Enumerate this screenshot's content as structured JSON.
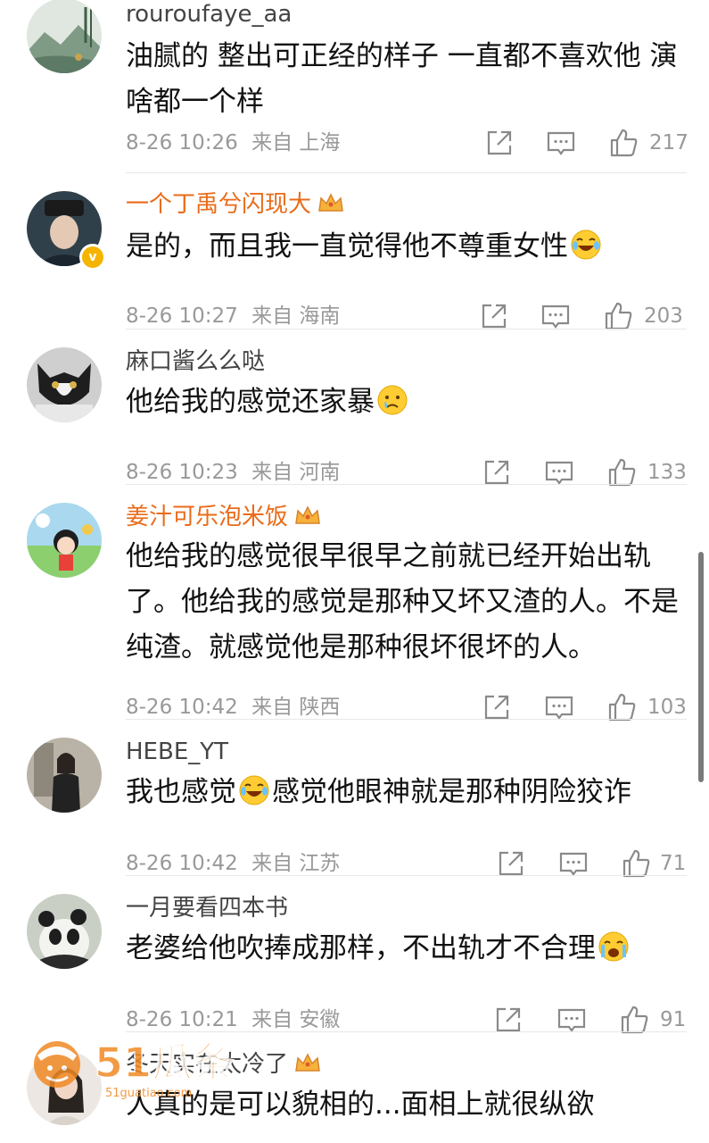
{
  "comments": [
    {
      "username": "rouroufaye_aa",
      "username_style": "normal",
      "verified": false,
      "crown": false,
      "text": "油腻的 整出可正经的样子 一直都不喜欢他 演啥都一个样",
      "emoji": null,
      "time": "8-26 10:26",
      "source": "来自",
      "location": "上海",
      "likes": "217",
      "avatar_desc": "landscape-painting-avatar"
    },
    {
      "username": "一个丁禹兮闪现大",
      "username_style": "vip",
      "verified": true,
      "crown": true,
      "text": "是的，而且我一直觉得他不尊重女性",
      "emoji": "laughing-crying-emoji",
      "time": "8-26 10:27",
      "source": "来自",
      "location": "海南",
      "likes": "203",
      "avatar_desc": "man-in-costume-hat-avatar"
    },
    {
      "username": "麻口酱么么哒",
      "username_style": "normal",
      "verified": false,
      "crown": false,
      "text": "他给我的感觉还家暴",
      "emoji": "sad-tear-emoji",
      "time": "8-26 10:23",
      "source": "来自",
      "location": "河南",
      "likes": "133",
      "avatar_desc": "cat-avatar"
    },
    {
      "username": "姜汁可乐泡米饭",
      "username_style": "vip",
      "verified": false,
      "crown": true,
      "text": "他给我的感觉很早很早之前就已经开始出轨了。他给我的感觉是那种又坏又渣的人。不是纯渣。就感觉他是那种很坏很坏的人。",
      "emoji": null,
      "time": "8-26 10:42",
      "source": "来自",
      "location": "陕西",
      "likes": "103",
      "avatar_desc": "cartoon-girl-avatar"
    },
    {
      "username": "HEBE_YT",
      "username_style": "normal",
      "verified": false,
      "crown": false,
      "text_before": "我也感觉",
      "text_after": "感觉他眼神就是那种阴险狡诈",
      "text": "",
      "emoji": "laughing-crying-emoji",
      "emoji_inline": true,
      "time": "8-26 10:42",
      "source": "来自",
      "location": "江苏",
      "likes": "71",
      "avatar_desc": "woman-sitting-avatar"
    },
    {
      "username": "一月要看四本书",
      "username_style": "normal",
      "verified": false,
      "crown": false,
      "text": "老婆给他吹捧成那样，不出轨才不合理",
      "emoji": "loudly-crying-emoji",
      "time": "8-26 10:21",
      "source": "来自",
      "location": "安徽",
      "likes": "91",
      "avatar_desc": "panda-avatar"
    },
    {
      "username": "冬天实在太冷了",
      "username_style": "normal",
      "verified": false,
      "crown": true,
      "text": "人真的是可以貌相的...面相上就很纵欲",
      "emoji": null,
      "time": "",
      "source": "",
      "location": "",
      "likes": "",
      "avatar_desc": "girl-avatar"
    }
  ],
  "watermark": {
    "brand": "51瓜条",
    "url": "51guatiao.com"
  },
  "colors": {
    "vip_name": "#e96b19",
    "normal_name": "#444444",
    "meta": "#999999",
    "text": "#111111",
    "verified_badge": "#f5b400"
  },
  "icons": [
    "repost-icon",
    "comment-icon",
    "like-icon",
    "crown-icon",
    "verified-icon"
  ]
}
